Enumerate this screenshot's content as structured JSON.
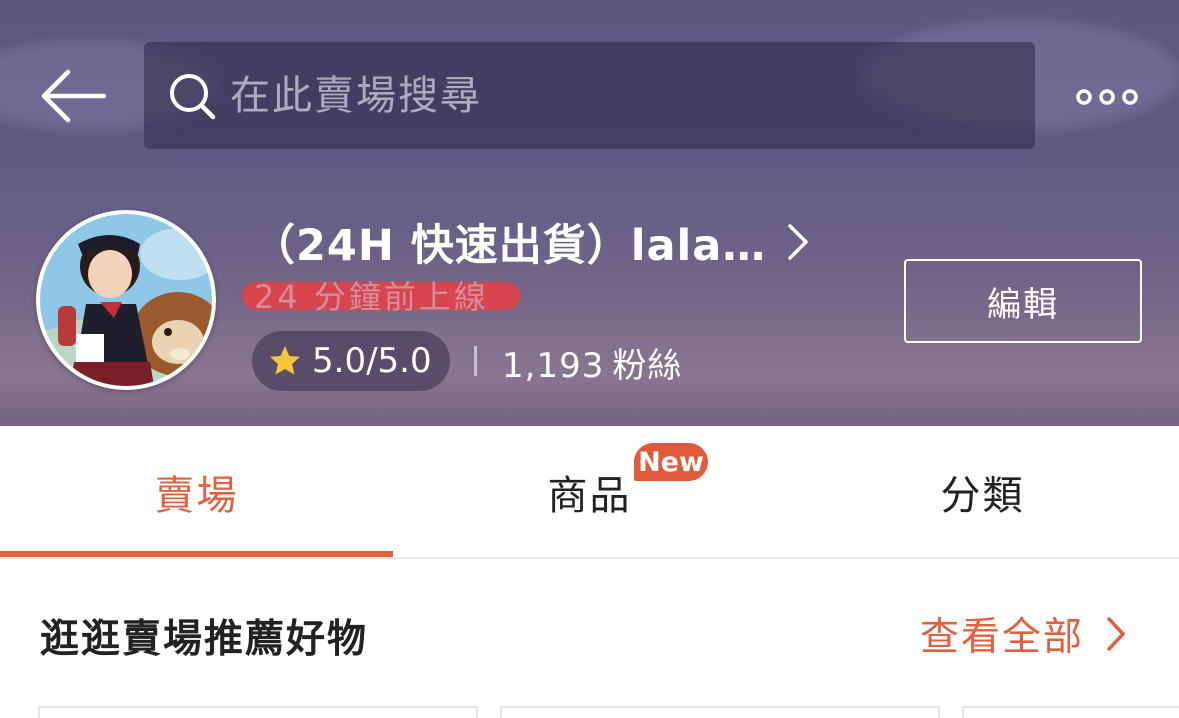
{
  "header": {
    "search": {
      "placeholder": "在此賣場搜尋"
    },
    "back_icon": "arrow-left-icon",
    "more_icon": "more-dots-icon"
  },
  "shop": {
    "name": "（24H 快速出貨）lala…",
    "online_status": "24 分鐘前上線",
    "rating": "5.0/5.0",
    "followers_count": "1,193",
    "followers_label": "粉絲",
    "edit_label": "編輯"
  },
  "tabs": [
    {
      "label": "賣場",
      "active": true
    },
    {
      "label": "商品",
      "badge": "New"
    },
    {
      "label": "分類"
    }
  ],
  "section": {
    "title": "逛逛賣場推薦好物",
    "see_all": "查看全部"
  },
  "colors": {
    "accent": "#e0603f",
    "banner": "#5f5a85",
    "badge": "#e05a3c"
  }
}
